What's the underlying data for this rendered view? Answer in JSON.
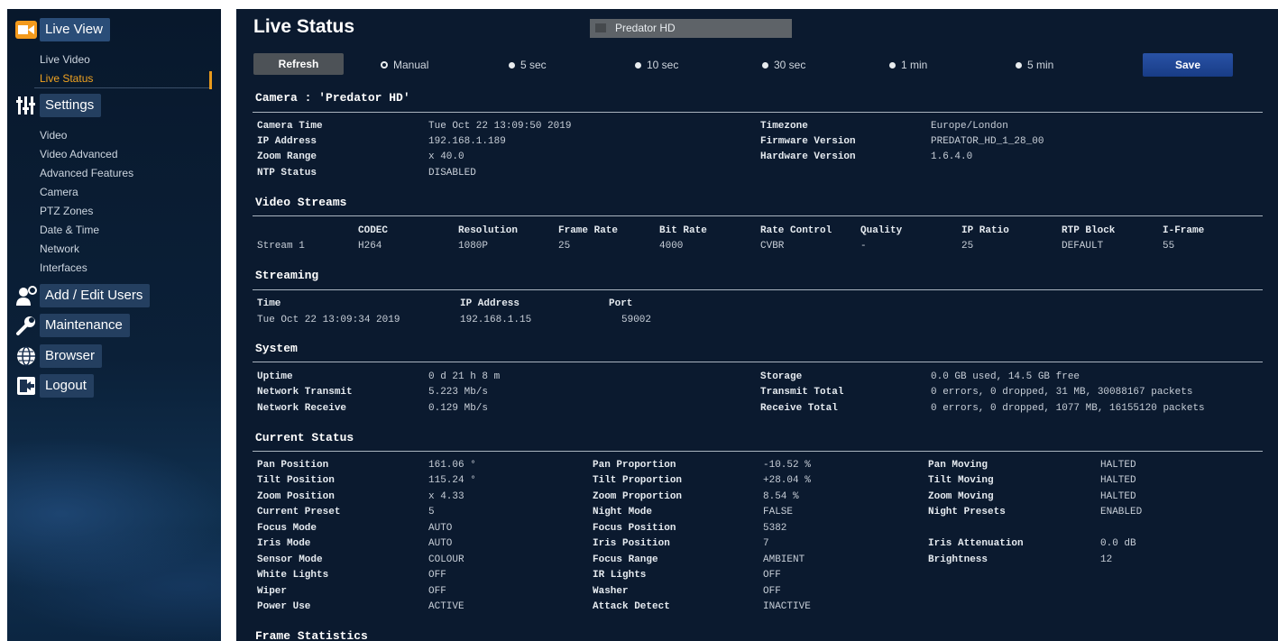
{
  "sidebar": {
    "live_view": "Live View",
    "live_video": "Live Video",
    "live_status": "Live Status",
    "settings": "Settings",
    "settings_items": [
      "Video",
      "Video Advanced",
      "Advanced Features",
      "Camera",
      "PTZ Zones",
      "Date & Time",
      "Network",
      "Interfaces"
    ],
    "add_edit_users": "Add / Edit Users",
    "maintenance": "Maintenance",
    "browser": "Browser",
    "logout": "Logout"
  },
  "header": {
    "title": "Live Status",
    "device": "Predator HD",
    "refresh_label": "Refresh",
    "save_label": "Save",
    "refresh_options": [
      "Manual",
      "5 sec",
      "10 sec",
      "30 sec",
      "1 min",
      "5 min"
    ],
    "selected_option": "Manual"
  },
  "camera": {
    "title": "Camera : 'Predator HD'",
    "left": [
      {
        "label": "Camera Time",
        "value": "Tue Oct 22 13:09:50 2019"
      },
      {
        "label": "IP Address",
        "value": "192.168.1.189"
      },
      {
        "label": "Zoom Range",
        "value": "x 40.0"
      },
      {
        "label": "NTP Status",
        "value": "DISABLED"
      }
    ],
    "right": [
      {
        "label": "Timezone",
        "value": "Europe/London"
      },
      {
        "label": "Firmware Version",
        "value": "PREDATOR_HD_1_28_00"
      },
      {
        "label": "Hardware Version",
        "value": "1.6.4.0"
      }
    ]
  },
  "video_streams": {
    "title": "Video Streams",
    "headers": [
      "CODEC",
      "Resolution",
      "Frame Rate",
      "Bit Rate",
      "Rate Control",
      "Quality",
      "IP Ratio",
      "RTP Block",
      "I-Frame"
    ],
    "rows": [
      {
        "name": "Stream 1",
        "cells": [
          "H264",
          "1080P",
          "25",
          "4000",
          "CVBR",
          "-",
          "25",
          "DEFAULT",
          "55"
        ]
      }
    ]
  },
  "streaming": {
    "title": "Streaming",
    "headers": [
      "Time",
      "IP Address",
      "Port"
    ],
    "row": [
      "Tue Oct 22 13:09:34 2019",
      "192.168.1.15",
      "59002"
    ]
  },
  "system": {
    "title": "System",
    "left": [
      {
        "label": "Uptime",
        "value": "0 d 21 h 8 m"
      },
      {
        "label": "Network Transmit",
        "value": "5.223 Mb/s"
      },
      {
        "label": "Network Receive",
        "value": "0.129 Mb/s"
      }
    ],
    "right": [
      {
        "label": "Storage",
        "value": "0.0 GB used, 14.5 GB free"
      },
      {
        "label": "Transmit Total",
        "value": "0 errors, 0 dropped, 31 MB, 30088167 packets"
      },
      {
        "label": "Receive Total",
        "value": "0 errors, 0 dropped, 1077 MB, 16155120 packets"
      }
    ]
  },
  "current_status": {
    "title": "Current Status",
    "col1": [
      {
        "label": "Pan Position",
        "value": "161.06 °"
      },
      {
        "label": "Tilt Position",
        "value": "115.24 °"
      },
      {
        "label": "Zoom Position",
        "value": "x 4.33"
      },
      {
        "label": "Current Preset",
        "value": "5"
      },
      {
        "label": "Focus Mode",
        "value": "AUTO"
      },
      {
        "label": "Iris Mode",
        "value": "AUTO"
      },
      {
        "label": "Sensor Mode",
        "value": "COLOUR"
      },
      {
        "label": "White Lights",
        "value": "OFF"
      },
      {
        "label": "Wiper",
        "value": "OFF"
      },
      {
        "label": "Power Use",
        "value": "ACTIVE"
      }
    ],
    "col2": [
      {
        "label": "Pan Proportion",
        "value": "-10.52 %"
      },
      {
        "label": "Tilt Proportion",
        "value": "+28.04 %"
      },
      {
        "label": "Zoom Proportion",
        "value": "8.54 %"
      },
      {
        "label": "Night Mode",
        "value": "FALSE"
      },
      {
        "label": "Focus Position",
        "value": "5382"
      },
      {
        "label": "Iris Position",
        "value": "7"
      },
      {
        "label": "Focus Range",
        "value": "AMBIENT"
      },
      {
        "label": "IR Lights",
        "value": "OFF"
      },
      {
        "label": "Washer",
        "value": "OFF"
      },
      {
        "label": "Attack Detect",
        "value": "INACTIVE"
      }
    ],
    "col3": [
      {
        "label": "Pan Moving",
        "value": "HALTED"
      },
      {
        "label": "Tilt Moving",
        "value": "HALTED"
      },
      {
        "label": "Zoom Moving",
        "value": "HALTED"
      },
      {
        "label": "Night Presets",
        "value": "ENABLED"
      },
      {
        "label": "",
        "value": ""
      },
      {
        "label": "Iris Attenuation",
        "value": "0.0 dB"
      },
      {
        "label": "Brightness",
        "value": "12"
      }
    ]
  },
  "frame_statistics": {
    "title": "Frame Statistics"
  },
  "colors": {
    "accent_orange": "#f0a320",
    "save_blue": "#2952a6",
    "panel_bg": "#0b1a2f"
  }
}
